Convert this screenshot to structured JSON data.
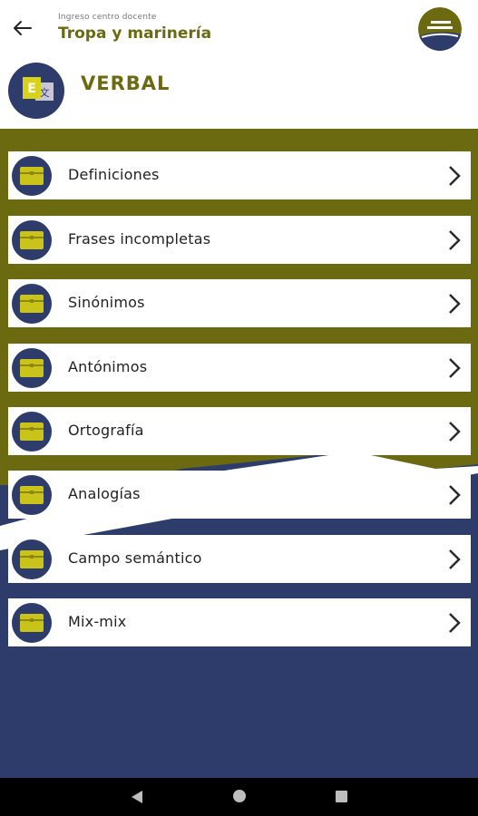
{
  "header": {
    "subtitle": "Ingreso centro docente",
    "title": "Tropa y marinería"
  },
  "section": {
    "title": "VERBAL",
    "icon": "translate-icon"
  },
  "items": [
    {
      "label": "Definiciones"
    },
    {
      "label": "Frases incompletas"
    },
    {
      "label": "Sinónimos"
    },
    {
      "label": "Antónimos"
    },
    {
      "label": "Ortografía"
    },
    {
      "label": "Analogías"
    },
    {
      "label": "Campo semántico"
    },
    {
      "label": "Mix-mix"
    }
  ],
  "colors": {
    "olive": "#6b6a10",
    "navy": "#2d3c6b",
    "white": "#ffffff"
  }
}
